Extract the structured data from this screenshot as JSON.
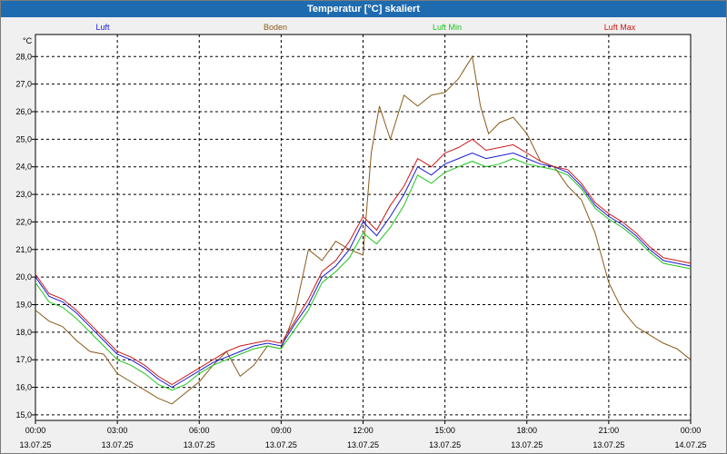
{
  "window": {
    "title": "Temperatur [°C] skaliert"
  },
  "colors": {
    "Luft": "#1a1ad6",
    "Boden": "#8a5a1a",
    "Luft Min": "#1cc41c",
    "Luft Max": "#cc1a1a",
    "titlebar": "#1f6bb0"
  },
  "chart_data": {
    "type": "line",
    "title": "Temperatur [°C] skaliert",
    "ylabel": "°C",
    "xlabel": "",
    "ylim": [
      14.8,
      28.8
    ],
    "xlim": [
      0,
      24
    ],
    "yticks": [
      "15,0",
      "16,0",
      "17,0",
      "18,0",
      "19,0",
      "20,0",
      "21,0",
      "22,0",
      "23,0",
      "24,0",
      "25,0",
      "26,0",
      "27,0",
      "28,0"
    ],
    "xticks": [
      {
        "time": "00:00",
        "date": "13.07.25"
      },
      {
        "time": "03:00",
        "date": "13.07.25"
      },
      {
        "time": "06:00",
        "date": "13.07.25"
      },
      {
        "time": "09:00",
        "date": "13.07.25"
      },
      {
        "time": "12:00",
        "date": "13.07.25"
      },
      {
        "time": "15:00",
        "date": "13.07.25"
      },
      {
        "time": "18:00",
        "date": "13.07.25"
      },
      {
        "time": "21:00",
        "date": "13.07.25"
      },
      {
        "time": "00:00",
        "date": "14.07.25"
      }
    ],
    "grid": true,
    "legend": "top",
    "series": [
      {
        "name": "Luft",
        "color": "#1a1ad6",
        "x": [
          0,
          0.5,
          1,
          1.5,
          2,
          2.5,
          3,
          3.5,
          4,
          4.5,
          5,
          5.5,
          6,
          6.5,
          7,
          7.5,
          8,
          8.5,
          9,
          9.5,
          10,
          10.5,
          11,
          11.5,
          12,
          12.5,
          13,
          13.5,
          14,
          14.5,
          15,
          15.5,
          16,
          16.5,
          17,
          17.5,
          18,
          18.5,
          19,
          19.5,
          20,
          20.5,
          21,
          21.5,
          22,
          22.5,
          23,
          23.5,
          24
        ],
        "y": [
          20.0,
          19.3,
          19.1,
          18.7,
          18.2,
          17.7,
          17.2,
          17.0,
          16.7,
          16.3,
          16.0,
          16.3,
          16.6,
          16.9,
          17.1,
          17.3,
          17.5,
          17.6,
          17.5,
          18.3,
          19.0,
          20.0,
          20.4,
          21.0,
          22.0,
          21.5,
          22.2,
          23.0,
          24.0,
          23.7,
          24.1,
          24.3,
          24.5,
          24.3,
          24.4,
          24.5,
          24.3,
          24.1,
          24.0,
          23.8,
          23.3,
          22.6,
          22.2,
          21.9,
          21.5,
          21.0,
          20.6,
          20.5,
          20.4
        ]
      },
      {
        "name": "Boden",
        "color": "#8a5a1a",
        "x": [
          0,
          0.5,
          1,
          1.5,
          2,
          2.5,
          3,
          3.5,
          4,
          4.5,
          5,
          5.5,
          6,
          6.5,
          7,
          7.5,
          8,
          8.5,
          9,
          9.5,
          10,
          10.5,
          11,
          11.5,
          12,
          12.3,
          12.6,
          13,
          13.5,
          14,
          14.5,
          15,
          15.5,
          16,
          16.3,
          16.6,
          17,
          17.5,
          18,
          18.5,
          19,
          19.5,
          20,
          20.5,
          21,
          21.5,
          22,
          22.5,
          23,
          23.5,
          24
        ],
        "y": [
          18.8,
          18.4,
          18.2,
          17.7,
          17.3,
          17.2,
          16.5,
          16.2,
          15.9,
          15.6,
          15.4,
          15.8,
          16.2,
          16.8,
          17.3,
          16.4,
          16.8,
          17.5,
          17.4,
          18.7,
          21.0,
          20.6,
          21.3,
          21.0,
          20.8,
          24.5,
          26.2,
          25.0,
          26.6,
          26.2,
          26.6,
          26.7,
          27.2,
          28.0,
          26.2,
          25.2,
          25.6,
          25.8,
          25.2,
          24.2,
          24.0,
          23.3,
          22.8,
          21.6,
          19.8,
          18.8,
          18.2,
          17.9,
          17.6,
          17.4,
          17.0
        ]
      },
      {
        "name": "Luft Min",
        "color": "#1cc41c",
        "x": [
          0,
          0.5,
          1,
          1.5,
          2,
          2.5,
          3,
          3.5,
          4,
          4.5,
          5,
          5.5,
          6,
          6.5,
          7,
          7.5,
          8,
          8.5,
          9,
          9.5,
          10,
          10.5,
          11,
          11.5,
          12,
          12.5,
          13,
          13.5,
          14,
          14.5,
          15,
          15.5,
          16,
          16.5,
          17,
          17.5,
          18,
          18.5,
          19,
          19.5,
          20,
          20.5,
          21,
          21.5,
          22,
          22.5,
          23,
          23.5,
          24
        ],
        "y": [
          19.8,
          19.1,
          18.9,
          18.5,
          18.0,
          17.5,
          17.0,
          16.8,
          16.5,
          16.1,
          15.9,
          16.1,
          16.5,
          16.8,
          17.0,
          17.2,
          17.4,
          17.5,
          17.4,
          18.1,
          18.8,
          19.8,
          20.2,
          20.7,
          21.6,
          21.2,
          21.8,
          22.6,
          23.7,
          23.4,
          23.8,
          24.0,
          24.2,
          24.0,
          24.1,
          24.3,
          24.1,
          24.0,
          23.9,
          23.7,
          23.2,
          22.5,
          22.1,
          21.8,
          21.4,
          20.9,
          20.5,
          20.4,
          20.3
        ]
      },
      {
        "name": "Luft Max",
        "color": "#cc1a1a",
        "x": [
          0,
          0.5,
          1,
          1.5,
          2,
          2.5,
          3,
          3.5,
          4,
          4.5,
          5,
          5.5,
          6,
          6.5,
          7,
          7.5,
          8,
          8.5,
          9,
          9.5,
          10,
          10.5,
          11,
          11.5,
          12,
          12.5,
          13,
          13.5,
          14,
          14.5,
          15,
          15.5,
          16,
          16.5,
          17,
          17.5,
          18,
          18.5,
          19,
          19.5,
          20,
          20.5,
          21,
          21.5,
          22,
          22.5,
          23,
          23.5,
          24
        ],
        "y": [
          20.1,
          19.4,
          19.2,
          18.8,
          18.3,
          17.8,
          17.3,
          17.1,
          16.8,
          16.4,
          16.1,
          16.4,
          16.7,
          17.0,
          17.3,
          17.5,
          17.6,
          17.7,
          17.6,
          18.4,
          19.2,
          20.2,
          20.6,
          21.3,
          22.2,
          21.7,
          22.6,
          23.3,
          24.3,
          24.0,
          24.5,
          24.7,
          25.0,
          24.6,
          24.7,
          24.8,
          24.5,
          24.2,
          24.0,
          23.9,
          23.4,
          22.7,
          22.3,
          22.0,
          21.6,
          21.1,
          20.7,
          20.6,
          20.5
        ]
      }
    ]
  }
}
